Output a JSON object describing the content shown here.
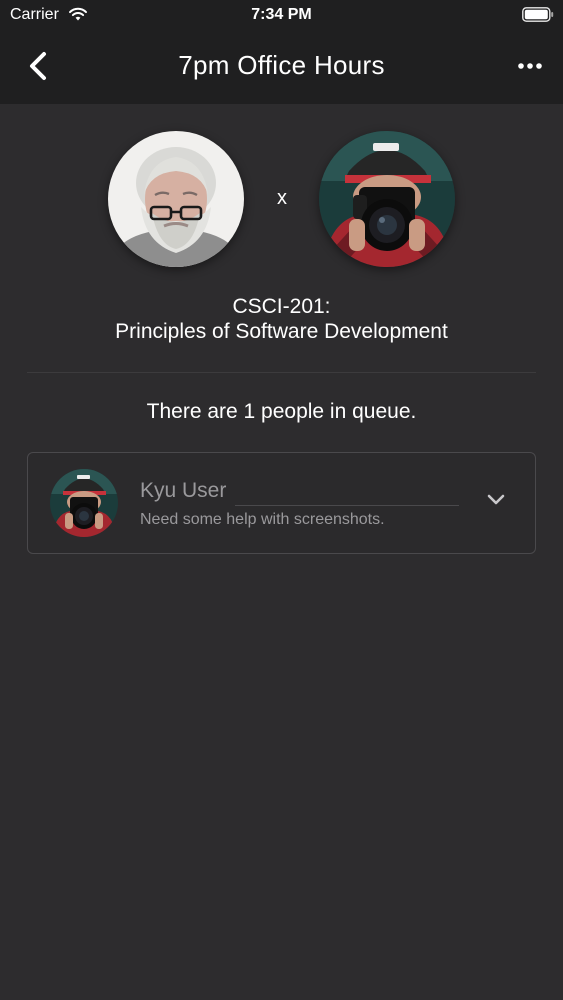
{
  "status_bar": {
    "carrier": "Carrier",
    "time": "7:34 PM",
    "wifi_icon": "wifi-icon",
    "battery_icon": "battery-icon"
  },
  "nav": {
    "title": "7pm Office Hours",
    "back_icon": "chevron-left-icon",
    "more_icon": "more-horizontal-icon"
  },
  "session": {
    "separator": "x",
    "course_code": "CSCI-201:",
    "course_name": "Principles of Software Development"
  },
  "queue": {
    "summary": "There are 1 people in queue.",
    "items": [
      {
        "name": "Kyu User",
        "message": "Need some help with screenshots.",
        "expand_icon": "chevron-down-icon"
      }
    ]
  },
  "colors": {
    "background": "#2d2c2e",
    "bar": "#1f1f20",
    "text": "#ffffff",
    "muted_text": "#9a999c",
    "border": "#4a494c"
  }
}
